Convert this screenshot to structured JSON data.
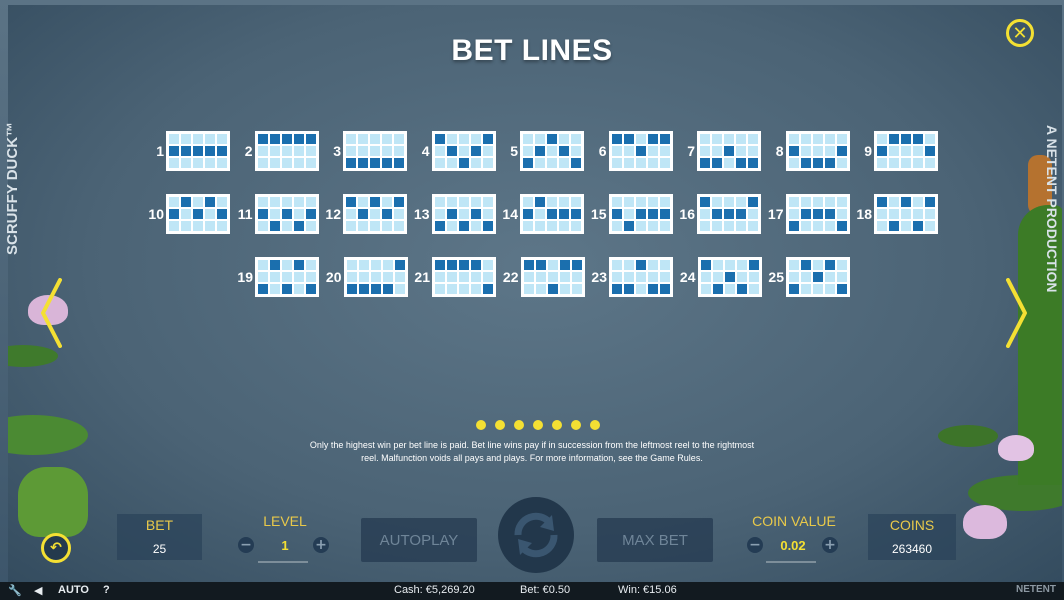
{
  "title": "BET LINES",
  "side_left": "SCRUFFY DUCK™",
  "side_right": "A NETENT PRODUCTION",
  "lines": [
    {
      "n": "1",
      "p": [
        [
          0,
          0,
          0,
          0,
          0
        ],
        [
          1,
          1,
          1,
          1,
          1
        ],
        [
          0,
          0,
          0,
          0,
          0
        ]
      ]
    },
    {
      "n": "2",
      "p": [
        [
          1,
          1,
          1,
          1,
          1
        ],
        [
          0,
          0,
          0,
          0,
          0
        ],
        [
          0,
          0,
          0,
          0,
          0
        ]
      ]
    },
    {
      "n": "3",
      "p": [
        [
          0,
          0,
          0,
          0,
          0
        ],
        [
          0,
          0,
          0,
          0,
          0
        ],
        [
          1,
          1,
          1,
          1,
          1
        ]
      ]
    },
    {
      "n": "4",
      "p": [
        [
          1,
          0,
          0,
          0,
          1
        ],
        [
          0,
          1,
          0,
          1,
          0
        ],
        [
          0,
          0,
          1,
          0,
          0
        ]
      ]
    },
    {
      "n": "5",
      "p": [
        [
          0,
          0,
          1,
          0,
          0
        ],
        [
          0,
          1,
          0,
          1,
          0
        ],
        [
          1,
          0,
          0,
          0,
          1
        ]
      ]
    },
    {
      "n": "6",
      "p": [
        [
          1,
          1,
          0,
          1,
          1
        ],
        [
          0,
          0,
          1,
          0,
          0
        ],
        [
          0,
          0,
          0,
          0,
          0
        ]
      ]
    },
    {
      "n": "7",
      "p": [
        [
          0,
          0,
          0,
          0,
          0
        ],
        [
          0,
          0,
          1,
          0,
          0
        ],
        [
          1,
          1,
          0,
          1,
          1
        ]
      ]
    },
    {
      "n": "8",
      "p": [
        [
          0,
          0,
          0,
          0,
          0
        ],
        [
          1,
          0,
          0,
          0,
          1
        ],
        [
          0,
          1,
          1,
          1,
          0
        ]
      ]
    },
    {
      "n": "9",
      "p": [
        [
          0,
          1,
          1,
          1,
          0
        ],
        [
          1,
          0,
          0,
          0,
          1
        ],
        [
          0,
          0,
          0,
          0,
          0
        ]
      ]
    },
    {
      "n": "10",
      "p": [
        [
          0,
          1,
          0,
          1,
          0
        ],
        [
          1,
          0,
          1,
          0,
          1
        ],
        [
          0,
          0,
          0,
          0,
          0
        ]
      ]
    },
    {
      "n": "11",
      "p": [
        [
          0,
          0,
          0,
          0,
          0
        ],
        [
          1,
          0,
          1,
          0,
          1
        ],
        [
          0,
          1,
          0,
          1,
          0
        ]
      ]
    },
    {
      "n": "12",
      "p": [
        [
          1,
          0,
          1,
          0,
          1
        ],
        [
          0,
          1,
          0,
          1,
          0
        ],
        [
          0,
          0,
          0,
          0,
          0
        ]
      ]
    },
    {
      "n": "13",
      "p": [
        [
          0,
          0,
          0,
          0,
          0
        ],
        [
          0,
          1,
          0,
          1,
          0
        ],
        [
          1,
          0,
          1,
          0,
          1
        ]
      ]
    },
    {
      "n": "14",
      "p": [
        [
          0,
          1,
          0,
          0,
          0
        ],
        [
          1,
          0,
          1,
          1,
          1
        ],
        [
          0,
          0,
          0,
          0,
          0
        ]
      ]
    },
    {
      "n": "15",
      "p": [
        [
          0,
          0,
          0,
          0,
          0
        ],
        [
          1,
          0,
          1,
          1,
          1
        ],
        [
          0,
          1,
          0,
          0,
          0
        ]
      ]
    },
    {
      "n": "16",
      "p": [
        [
          1,
          0,
          0,
          0,
          1
        ],
        [
          0,
          1,
          1,
          1,
          0
        ],
        [
          0,
          0,
          0,
          0,
          0
        ]
      ]
    },
    {
      "n": "17",
      "p": [
        [
          0,
          0,
          0,
          0,
          0
        ],
        [
          0,
          1,
          1,
          1,
          0
        ],
        [
          1,
          0,
          0,
          0,
          1
        ]
      ]
    },
    {
      "n": "18",
      "p": [
        [
          1,
          0,
          1,
          0,
          1
        ],
        [
          0,
          0,
          0,
          0,
          0
        ],
        [
          0,
          1,
          0,
          1,
          0
        ]
      ]
    },
    {
      "n": "19",
      "p": [
        [
          0,
          1,
          0,
          1,
          0
        ],
        [
          0,
          0,
          0,
          0,
          0
        ],
        [
          1,
          0,
          1,
          0,
          1
        ]
      ]
    },
    {
      "n": "20",
      "p": [
        [
          0,
          0,
          0,
          0,
          1
        ],
        [
          0,
          0,
          0,
          0,
          0
        ],
        [
          1,
          1,
          1,
          1,
          0
        ]
      ]
    },
    {
      "n": "21",
      "p": [
        [
          1,
          1,
          1,
          1,
          0
        ],
        [
          0,
          0,
          0,
          0,
          0
        ],
        [
          0,
          0,
          0,
          0,
          1
        ]
      ]
    },
    {
      "n": "22",
      "p": [
        [
          1,
          1,
          0,
          1,
          1
        ],
        [
          0,
          0,
          0,
          0,
          0
        ],
        [
          0,
          0,
          1,
          0,
          0
        ]
      ]
    },
    {
      "n": "23",
      "p": [
        [
          0,
          0,
          1,
          0,
          0
        ],
        [
          0,
          0,
          0,
          0,
          0
        ],
        [
          1,
          1,
          0,
          1,
          1
        ]
      ]
    },
    {
      "n": "24",
      "p": [
        [
          1,
          0,
          0,
          0,
          1
        ],
        [
          0,
          0,
          1,
          0,
          0
        ],
        [
          0,
          1,
          0,
          1,
          0
        ]
      ]
    },
    {
      "n": "25",
      "p": [
        [
          0,
          1,
          0,
          1,
          0
        ],
        [
          0,
          0,
          1,
          0,
          0
        ],
        [
          1,
          0,
          0,
          0,
          1
        ]
      ]
    }
  ],
  "pager_dot_count": 7,
  "info_text": "Only the highest win per bet line is paid. Bet line wins pay if in succession from the leftmost reel to the rightmost reel. Malfunction voids all pays and plays. For more information, see the Game Rules.",
  "panel": {
    "bet_label": "BET",
    "bet_value": "25",
    "level_label": "LEVEL",
    "level_value": "1",
    "autoplay_label": "AUTOPLAY",
    "maxbet_label": "MAX BET",
    "coin_value_label": "COIN VALUE",
    "coin_value": "0.02",
    "coins_label": "COINS",
    "coins_value": "263460",
    "minus": "−",
    "plus": "+"
  },
  "status": {
    "auto_label": "AUTO",
    "help": "?",
    "cash": "Cash: €5,269.20",
    "bet": "Bet: €0.50",
    "win": "Win: €15.06",
    "brand": "NETENT"
  },
  "colors": {
    "accent": "#f4e033",
    "cell_on": "#1b6fae",
    "cell_off": "#bfe6f6",
    "label_gold": "#e9c94a"
  }
}
